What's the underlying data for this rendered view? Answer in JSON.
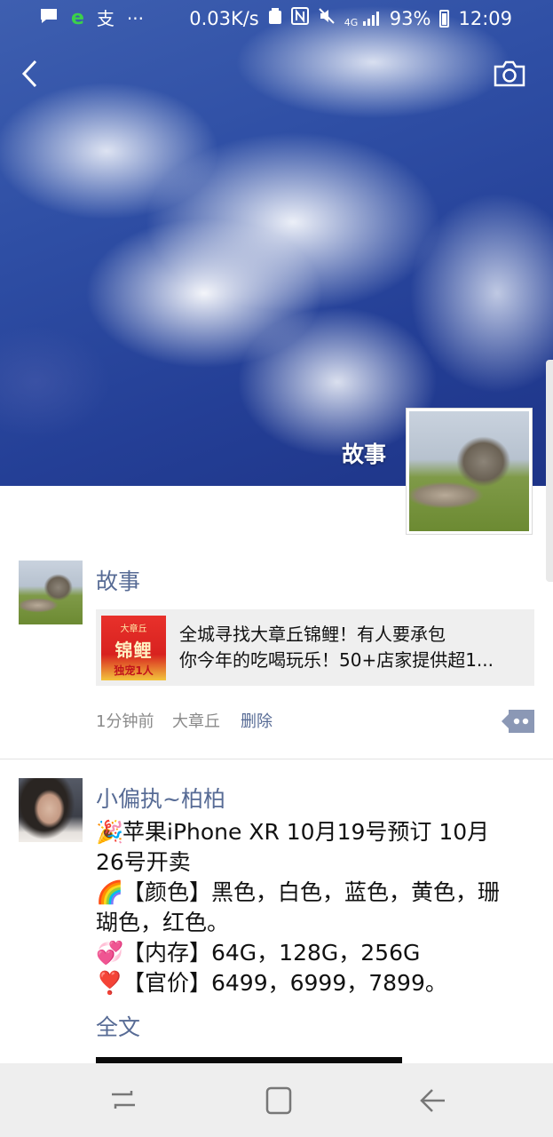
{
  "status_bar": {
    "network_speed": "0.03K/s",
    "network_type": "4G",
    "battery": "93%",
    "time": "12:09",
    "icons": [
      "chat-bubble-icon",
      "browser-e-icon",
      "alipay-icon",
      "more-dots-icon",
      "recycle-icon",
      "nfc-icon",
      "mute-icon",
      "signal-icon",
      "battery-icon"
    ],
    "alipay_glyph": "支",
    "dots": "···"
  },
  "header": {
    "cover_name": "故事"
  },
  "colors": {
    "link_blue": "#576b95",
    "meta_gray": "#8a8a8a",
    "card_bg": "#efefef",
    "nav_bg": "#eeeeee"
  },
  "posts": [
    {
      "user": "故事",
      "link_card": {
        "thumb_top": "大章丘",
        "thumb_main": "锦鲤",
        "thumb_bottom": "独宠1人",
        "title_line1": "全城寻找大章丘锦鲤！有人要承包",
        "title_line2": "你今年的吃喝玩乐！50+店家提供超1..."
      },
      "time": "1分钟前",
      "location": "大章丘",
      "delete": "删除"
    },
    {
      "user": "小偏执~柏柏",
      "lines": [
        {
          "emoji": "🎉",
          "text": "苹果iPhone XR   10月19号预订 10月"
        },
        {
          "emoji": "",
          "text": "26号开卖"
        },
        {
          "emoji": "🌈",
          "text": "【颜色】黑色，白色，蓝色，黄色，珊"
        },
        {
          "emoji": "",
          "text": "瑚色，红色。"
        },
        {
          "emoji": "💞",
          "text": "【内存】64G，128G，256G"
        },
        {
          "emoji": "❣️",
          "text": "【官价】6499，6999，7899。"
        }
      ],
      "full_text": "全文"
    }
  ]
}
